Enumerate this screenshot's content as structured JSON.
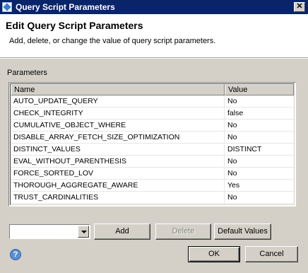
{
  "window": {
    "title": "Query Script Parameters",
    "close_label": "✕"
  },
  "header": {
    "title": "Edit Query Script Parameters",
    "description": "Add, delete, or change the value of query script parameters."
  },
  "params_label": "Parameters",
  "table": {
    "columns": [
      "Name",
      "Value"
    ],
    "rows": [
      [
        "AUTO_UPDATE_QUERY",
        "No"
      ],
      [
        "CHECK_INTEGRITY",
        "false"
      ],
      [
        "CUMULATIVE_OBJECT_WHERE",
        "No"
      ],
      [
        "DISABLE_ARRAY_FETCH_SIZE_OPTIMIZATION",
        "No"
      ],
      [
        "DISTINCT_VALUES",
        "DISTINCT"
      ],
      [
        "EVAL_WITHOUT_PARENTHESIS",
        "No"
      ],
      [
        "FORCE_SORTED_LOV",
        "No"
      ],
      [
        "THOROUGH_AGGREGATE_AWARE",
        "Yes"
      ],
      [
        "TRUST_CARDINALITIES",
        "No"
      ]
    ]
  },
  "buttons": {
    "add": "Add",
    "delete": "Delete",
    "default_values": "Default Values",
    "ok": "OK",
    "cancel": "Cancel"
  },
  "help_icon": "?"
}
